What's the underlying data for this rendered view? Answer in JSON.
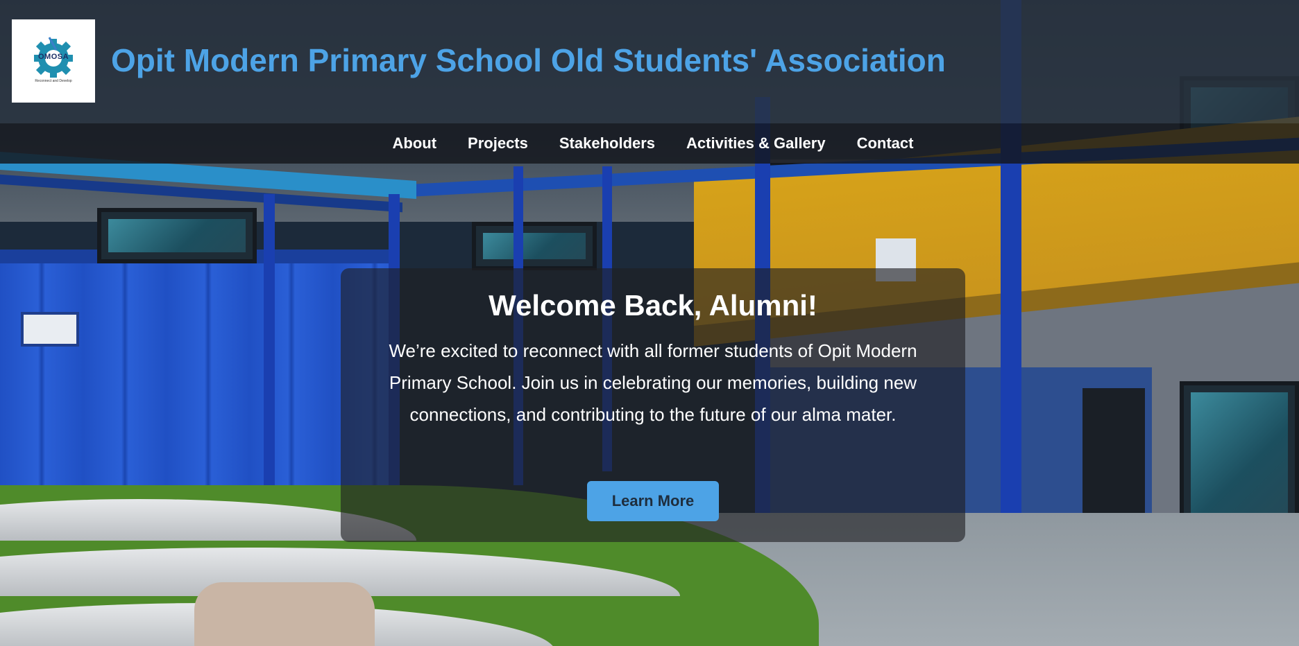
{
  "header": {
    "logo": {
      "name": "OMOSA",
      "tagline": "Reconnect and Develop",
      "icon": "gear-logo-icon"
    },
    "title": "Opit Modern Primary School Old Students' Association"
  },
  "nav": {
    "items": [
      {
        "label": "About"
      },
      {
        "label": "Projects"
      },
      {
        "label": "Stakeholders"
      },
      {
        "label": "Activities & Gallery"
      },
      {
        "label": "Contact"
      }
    ]
  },
  "hero": {
    "title": "Welcome Back, Alumni!",
    "text": "We’re excited to reconnect with all former students of Opit Modern Primary School. Join us in celebrating our memories, building new connections, and contributing to the future of our alma mater.",
    "button_label": "Learn More"
  },
  "colors": {
    "accent": "#4da3e6",
    "header_bg": "#28323e",
    "nav_bg": "#14161c",
    "button_text": "#1e2d3d"
  }
}
